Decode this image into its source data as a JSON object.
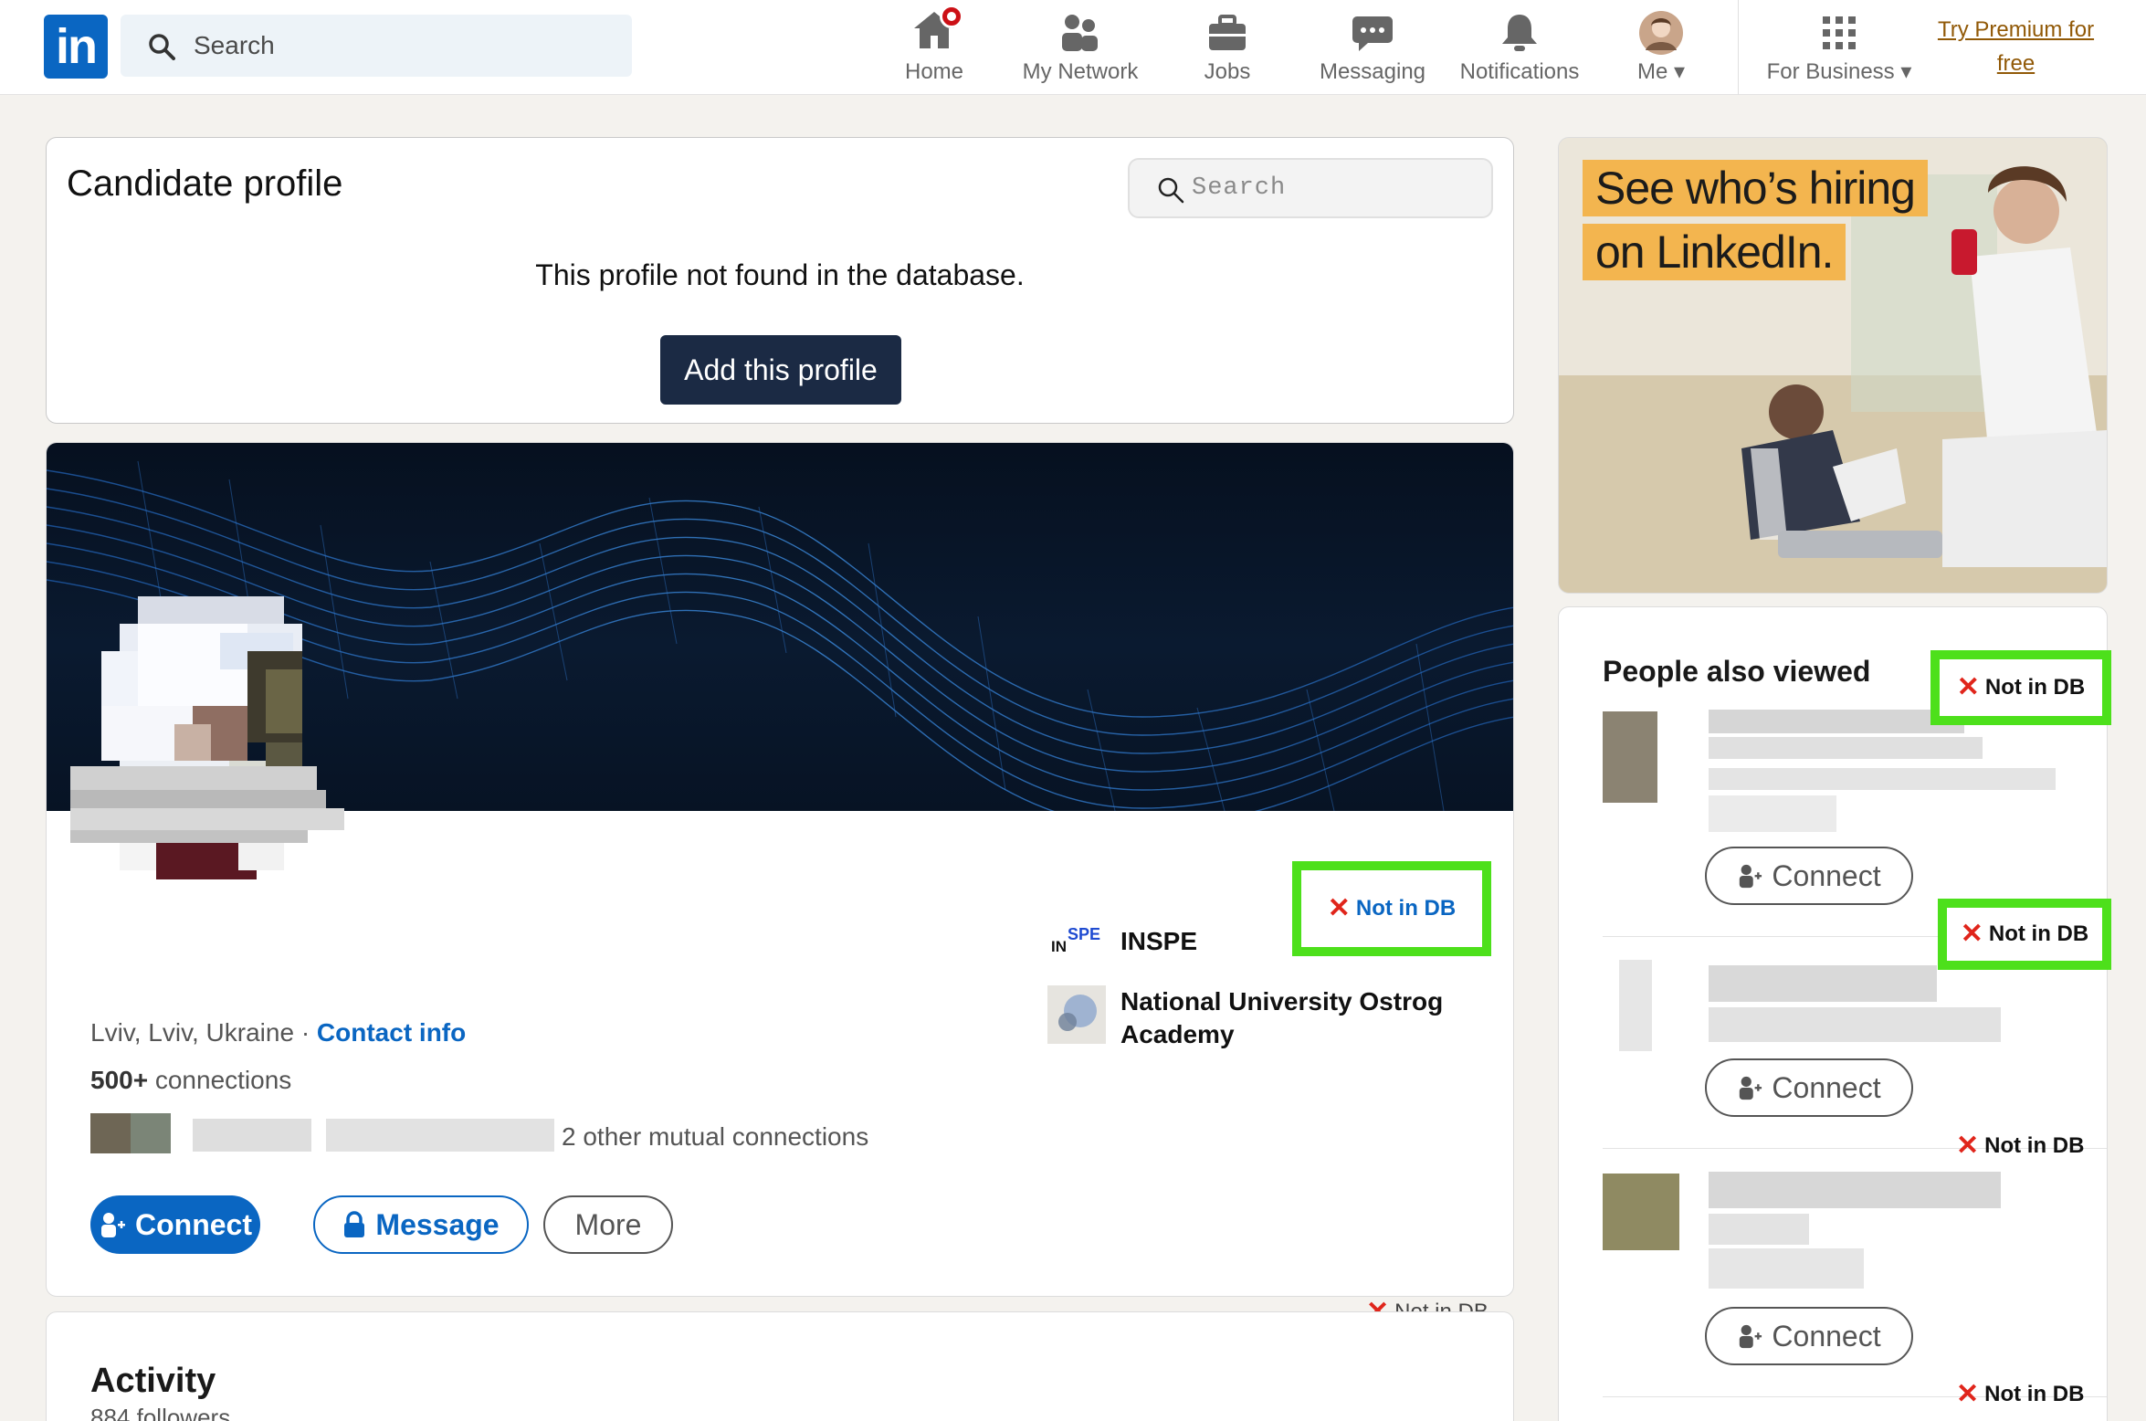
{
  "topnav": {
    "logo_text": "in",
    "search_placeholder": "Search",
    "items": [
      {
        "label": "Home",
        "icon": "home-icon"
      },
      {
        "label": "My Network",
        "icon": "network-icon"
      },
      {
        "label": "Jobs",
        "icon": "briefcase-icon"
      },
      {
        "label": "Messaging",
        "icon": "chat-icon"
      },
      {
        "label": "Notifications",
        "icon": "bell-icon"
      },
      {
        "label": "Me",
        "icon": "avatar"
      },
      {
        "label": "For Business",
        "icon": "grid-icon"
      }
    ],
    "premium_line1": "Try Premium for",
    "premium_line2": "free"
  },
  "candidate": {
    "title": "Candidate profile",
    "search_placeholder": "Search",
    "message": "This profile not found in the database.",
    "add_button": "Add this profile"
  },
  "profile": {
    "location": "Lviv, Lviv, Ukraine",
    "separator": "·",
    "contact_link": "Contact info",
    "connections_count": "500+",
    "connections_label": "connections",
    "mutual_text": "2 other mutual connections",
    "connect_label": "Connect",
    "message_label": "Message",
    "more_label": "More",
    "status": "Not in DB",
    "education": [
      {
        "logo": "INSPE",
        "name": "INSPE"
      },
      {
        "logo": "",
        "name_line1": "National University Ostrog",
        "name_line2": "Academy"
      }
    ]
  },
  "activity": {
    "status": "Not in DB",
    "title": "Activity",
    "followers": "884 followers"
  },
  "ad": {
    "line1": "See who’s hiring",
    "line2": "on LinkedIn."
  },
  "people_also_viewed": {
    "title": "People also viewed",
    "status": "Not in DB",
    "connect_label": "Connect"
  },
  "colors": {
    "linkedin_blue": "#0a66c2",
    "highlight_green": "#4de01b",
    "error_red": "#e0251b",
    "dark_button": "#1b2a44",
    "premium_gold": "#915907"
  }
}
